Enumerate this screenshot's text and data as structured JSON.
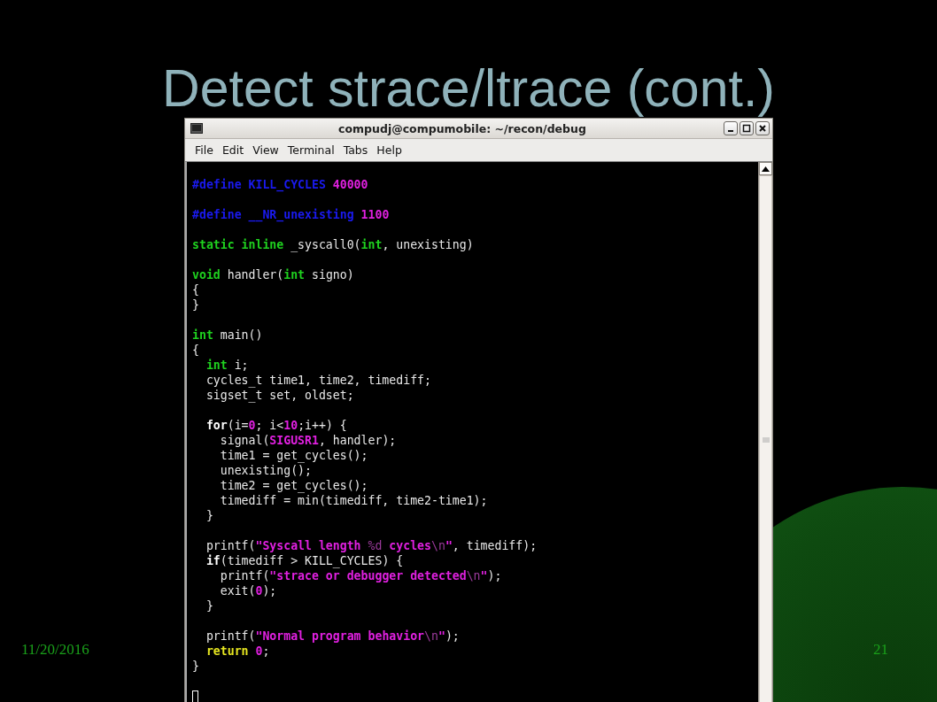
{
  "slide": {
    "title": "Detect strace/ltrace (cont.)",
    "date": "11/20/2016",
    "page_number": "21"
  },
  "terminal": {
    "title": "compudj@compumobile: ~/recon/debug",
    "menu": [
      "File",
      "Edit",
      "View",
      "Terminal",
      "Tabs",
      "Help"
    ],
    "lines": [
      {
        "kind": "blank"
      },
      {
        "kind": "code",
        "segments": [
          {
            "text": "#define KILL_CYCLES ",
            "kind": "preproc"
          },
          {
            "text": "40000",
            "kind": "number"
          }
        ]
      },
      {
        "kind": "blank"
      },
      {
        "kind": "code",
        "segments": [
          {
            "text": "#define __NR_unexisting ",
            "kind": "preproc"
          },
          {
            "text": "1100",
            "kind": "number"
          }
        ]
      },
      {
        "kind": "blank"
      },
      {
        "kind": "code",
        "segments": [
          {
            "text": "static inline",
            "kind": "type"
          },
          {
            "text": " _syscall0(",
            "kind": "plain"
          },
          {
            "text": "int",
            "kind": "type"
          },
          {
            "text": ", unexisting)",
            "kind": "plain"
          }
        ]
      },
      {
        "kind": "blank"
      },
      {
        "kind": "code",
        "segments": [
          {
            "text": "void",
            "kind": "type"
          },
          {
            "text": " handler(",
            "kind": "plain"
          },
          {
            "text": "int",
            "kind": "type"
          },
          {
            "text": " signo)",
            "kind": "plain"
          }
        ]
      },
      {
        "kind": "code",
        "segments": [
          {
            "text": "{",
            "kind": "plain"
          }
        ]
      },
      {
        "kind": "code",
        "segments": [
          {
            "text": "}",
            "kind": "plain"
          }
        ]
      },
      {
        "kind": "blank"
      },
      {
        "kind": "code",
        "segments": [
          {
            "text": "int",
            "kind": "type"
          },
          {
            "text": " main()",
            "kind": "plain"
          }
        ]
      },
      {
        "kind": "code",
        "segments": [
          {
            "text": "{",
            "kind": "plain"
          }
        ]
      },
      {
        "kind": "code",
        "segments": [
          {
            "text": "  int",
            "kind": "type"
          },
          {
            "text": " i;",
            "kind": "plain"
          }
        ]
      },
      {
        "kind": "code",
        "segments": [
          {
            "text": "  cycles_t time1, time2, timediff;",
            "kind": "plain"
          }
        ]
      },
      {
        "kind": "code",
        "segments": [
          {
            "text": "  sigset_t set, oldset;",
            "kind": "plain"
          }
        ]
      },
      {
        "kind": "blank"
      },
      {
        "kind": "code",
        "segments": [
          {
            "text": "  for",
            "kind": "keyword"
          },
          {
            "text": "(i=",
            "kind": "plain"
          },
          {
            "text": "0",
            "kind": "number"
          },
          {
            "text": "; i<",
            "kind": "plain"
          },
          {
            "text": "10",
            "kind": "number"
          },
          {
            "text": ";i++) {",
            "kind": "plain"
          }
        ]
      },
      {
        "kind": "code",
        "segments": [
          {
            "text": "    signal(",
            "kind": "plain"
          },
          {
            "text": "SIGUSR1",
            "kind": "number"
          },
          {
            "text": ", handler);",
            "kind": "plain"
          }
        ]
      },
      {
        "kind": "code",
        "segments": [
          {
            "text": "    time1 = get_cycles();",
            "kind": "plain"
          }
        ]
      },
      {
        "kind": "code",
        "segments": [
          {
            "text": "    unexisting();",
            "kind": "plain"
          }
        ]
      },
      {
        "kind": "code",
        "segments": [
          {
            "text": "    time2 = get_cycles();",
            "kind": "plain"
          }
        ]
      },
      {
        "kind": "code",
        "segments": [
          {
            "text": "    timediff = min(timediff, time2-time1);",
            "kind": "plain"
          }
        ]
      },
      {
        "kind": "code",
        "segments": [
          {
            "text": "  }",
            "kind": "plain"
          }
        ]
      },
      {
        "kind": "blank"
      },
      {
        "kind": "code",
        "segments": [
          {
            "text": "  printf(",
            "kind": "plain"
          },
          {
            "text": "\"Syscall length ",
            "kind": "string"
          },
          {
            "text": "%d",
            "kind": "escape"
          },
          {
            "text": " cycles",
            "kind": "string"
          },
          {
            "text": "\\n",
            "kind": "escape"
          },
          {
            "text": "\"",
            "kind": "string"
          },
          {
            "text": ", timediff);",
            "kind": "plain"
          }
        ]
      },
      {
        "kind": "code",
        "segments": [
          {
            "text": "  if",
            "kind": "keyword"
          },
          {
            "text": "(timediff > KILL_CYCLES) {",
            "kind": "plain"
          }
        ]
      },
      {
        "kind": "code",
        "segments": [
          {
            "text": "    printf(",
            "kind": "plain"
          },
          {
            "text": "\"strace or debugger detected",
            "kind": "string"
          },
          {
            "text": "\\n",
            "kind": "escape"
          },
          {
            "text": "\"",
            "kind": "string"
          },
          {
            "text": ");",
            "kind": "plain"
          }
        ]
      },
      {
        "kind": "code",
        "segments": [
          {
            "text": "    exit(",
            "kind": "plain"
          },
          {
            "text": "0",
            "kind": "number"
          },
          {
            "text": ");",
            "kind": "plain"
          }
        ]
      },
      {
        "kind": "code",
        "segments": [
          {
            "text": "  }",
            "kind": "plain"
          }
        ]
      },
      {
        "kind": "blank"
      },
      {
        "kind": "code",
        "segments": [
          {
            "text": "  printf(",
            "kind": "plain"
          },
          {
            "text": "\"Normal program behavior",
            "kind": "string"
          },
          {
            "text": "\\n",
            "kind": "escape"
          },
          {
            "text": "\"",
            "kind": "string"
          },
          {
            "text": ");",
            "kind": "plain"
          }
        ]
      },
      {
        "kind": "code",
        "segments": [
          {
            "text": "  return ",
            "kind": "statement"
          },
          {
            "text": "0",
            "kind": "number"
          },
          {
            "text": ";",
            "kind": "plain"
          }
        ]
      },
      {
        "kind": "code",
        "segments": [
          {
            "text": "}",
            "kind": "plain"
          }
        ]
      },
      {
        "kind": "blank"
      },
      {
        "kind": "cursor"
      }
    ]
  }
}
